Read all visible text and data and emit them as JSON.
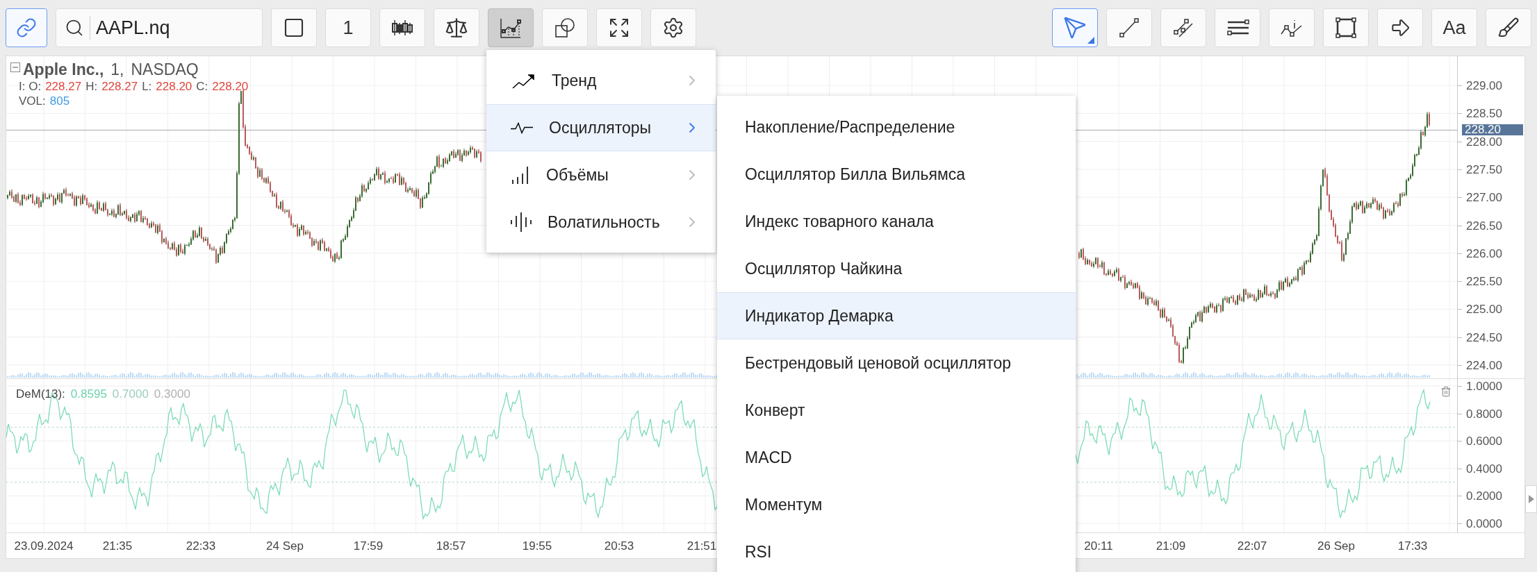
{
  "toolbar": {
    "link_button": {
      "selected": true
    },
    "search": {
      "value": "AAPL.nq"
    },
    "tool_buttons": [
      {
        "kind": "icon",
        "pressed": false
      },
      {
        "kind": "text",
        "label": "1",
        "pressed": false
      },
      {
        "kind": "icon",
        "pressed": false
      },
      {
        "kind": "icon",
        "pressed": false
      },
      {
        "kind": "icon",
        "pressed": true
      },
      {
        "kind": "icon",
        "pressed": false
      },
      {
        "kind": "icon",
        "pressed": false
      },
      {
        "kind": "icon",
        "pressed": false
      }
    ],
    "drawing_buttons": [
      {
        "kind": "icon",
        "selected": true
      },
      {
        "kind": "icon",
        "selected": false
      },
      {
        "kind": "icon",
        "selected": false
      },
      {
        "kind": "icon",
        "selected": false
      },
      {
        "kind": "icon",
        "selected": false
      },
      {
        "kind": "icon",
        "selected": false
      },
      {
        "kind": "icon",
        "selected": false
      },
      {
        "kind": "text",
        "label": "Aa",
        "selected": false
      },
      {
        "kind": "icon",
        "selected": false
      }
    ]
  },
  "legend": {
    "symbol": "Apple Inc.,",
    "interval": "1,",
    "exchange": "NASDAQ",
    "quotes": [
      {
        "label": "I: O:",
        "value": "228.27",
        "color": "#e0463c"
      },
      {
        "label": "H:",
        "value": "228.27",
        "color": "#e0463c"
      },
      {
        "label": "L:",
        "value": "228.20",
        "color": "#e0463c"
      },
      {
        "label": "C:",
        "value": "228.20",
        "color": "#e0463c"
      }
    ],
    "volume": {
      "label": "VOL:",
      "value": "805",
      "color": "#3f9be8"
    }
  },
  "price_axis": {
    "ticks": [
      "229.00",
      "228.50",
      "228.00",
      "227.50",
      "227.00",
      "226.50",
      "226.00",
      "225.50",
      "225.00",
      "224.50",
      "224.00"
    ],
    "current_price": "228.20"
  },
  "indicator": {
    "name": "DeM(13):",
    "values": [
      {
        "text": "0.8595",
        "color": "#6fd3ab"
      },
      {
        "text": "0.7000",
        "color": "#9ccfba"
      },
      {
        "text": "0.3000",
        "color": "#b0b0b0"
      }
    ],
    "ticks": [
      "1.0000",
      "0.8000",
      "0.6000",
      "0.4000",
      "0.2000",
      "0.0000"
    ]
  },
  "time_axis": {
    "labels": [
      "23.09.2024",
      "21:35",
      "22:33",
      "24 Sep",
      "17:59",
      "18:57",
      "19:55",
      "20:53",
      "21:51",
      "20:11",
      "21:09",
      "22:07",
      "26 Sep",
      "17:33"
    ]
  },
  "menu": {
    "items": [
      {
        "label": "Тренд",
        "selected": false
      },
      {
        "label": "Осцилляторы",
        "selected": true
      },
      {
        "label": "Объёмы",
        "selected": false
      },
      {
        "label": "Волатильность",
        "selected": false
      }
    ]
  },
  "submenu": {
    "items": [
      {
        "label": "Накопление/Распределение",
        "selected": false
      },
      {
        "label": "Осциллятор Билла Вильямса",
        "selected": false
      },
      {
        "label": "Индекс товарного канала",
        "selected": false
      },
      {
        "label": "Осциллятор Чайкина",
        "selected": false
      },
      {
        "label": "Индикатор Демарка",
        "selected": true
      },
      {
        "label": "Бестрендовый ценовой осциллятор",
        "selected": false
      },
      {
        "label": "Конверт",
        "selected": false
      },
      {
        "label": "MACD",
        "selected": false
      },
      {
        "label": "Моментум",
        "selected": false
      },
      {
        "label": "RSI",
        "selected": false
      }
    ]
  }
}
